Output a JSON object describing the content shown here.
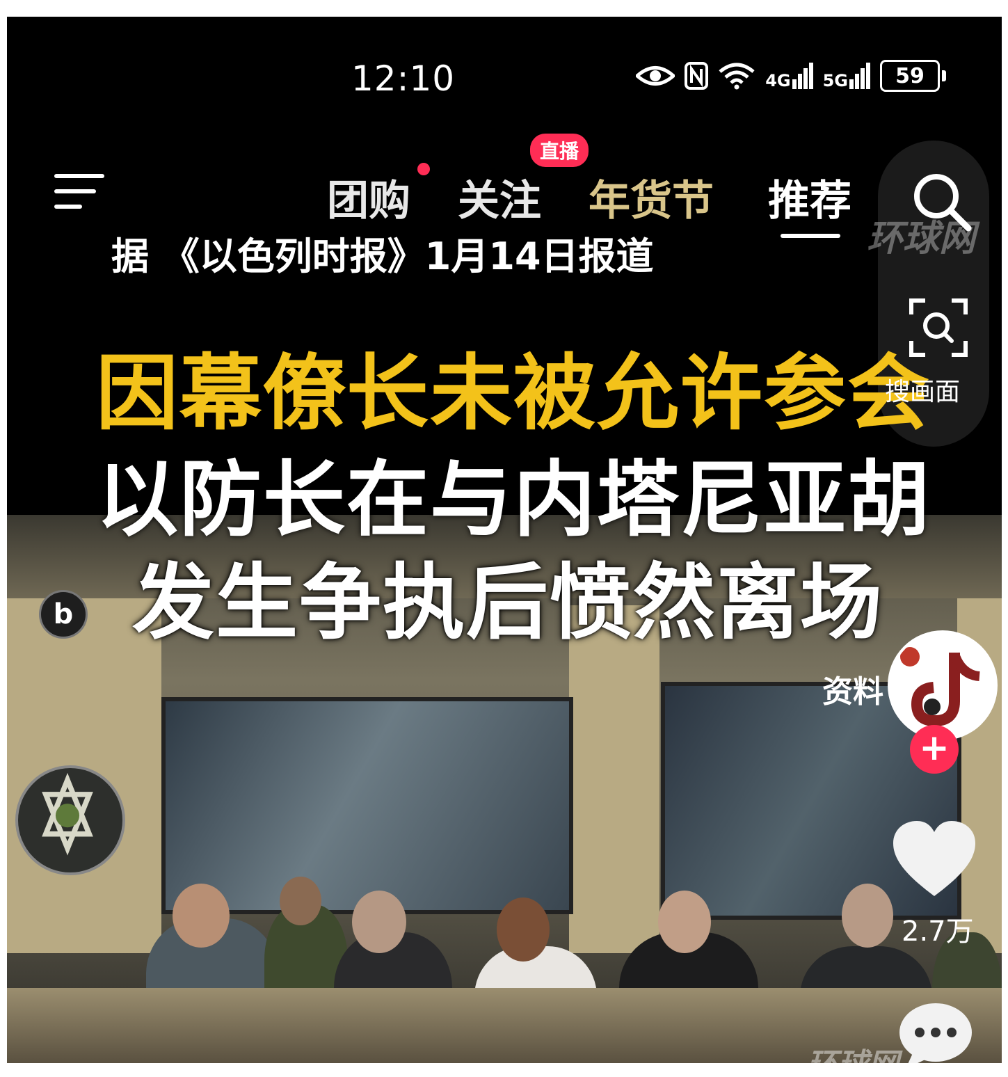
{
  "status_bar": {
    "time": "12:10",
    "network_4g": "4G",
    "network_5g": "5G",
    "battery": "59"
  },
  "nav": {
    "tabs": [
      {
        "label": "",
        "active": false
      },
      {
        "label": "团购",
        "active": false
      },
      {
        "label": "关注",
        "active": false
      },
      {
        "label": "年货节",
        "active": false
      },
      {
        "label": "推荐",
        "active": true
      }
    ],
    "live_badge": "直播"
  },
  "video": {
    "report_line": "据 《以色列时报》1月14日报道",
    "headline_line1": "因幕僚长未被允许参会",
    "headline_line2": "以防长在与内塔尼亚胡",
    "headline_line3": "发生争执后愤然离场",
    "source_label": "资料",
    "watermark_top": "环球网",
    "watermark_bottom": "环球网"
  },
  "right_rail": {
    "search_frame_label": "搜画面",
    "like_count": "2.7万"
  },
  "colors": {
    "accent": "#ff2d55",
    "headline_yellow": "#f3c21a"
  }
}
